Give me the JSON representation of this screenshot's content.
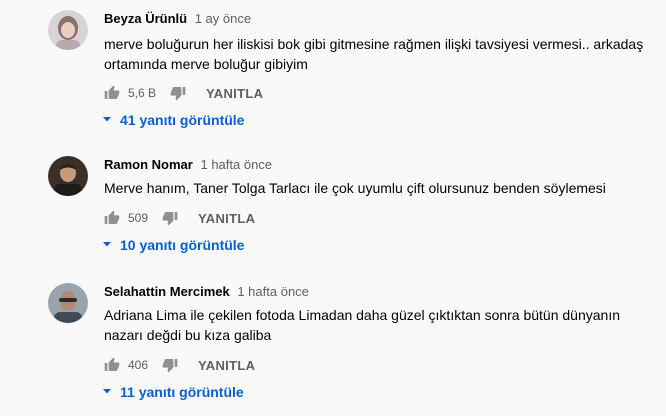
{
  "colors": {
    "link": "#065fd4",
    "meta": "#606060",
    "text": "#030303",
    "background": "#f9f9f9"
  },
  "comments": [
    {
      "author": "Beyza Ürünlü",
      "time": "1 ay önce",
      "text_lines": [
        "merve boluğurun her iliskisi bok gibi gitmesine rağmen ilişki tavsiyesi vermesi.. arkadaş",
        "ortamında merve boluğur gibiyim"
      ],
      "likes": "5,6 B",
      "reply_label": "YANITLA",
      "replies_label": "41 yanıtı görüntüle",
      "like_icon": "thumbs-up-icon",
      "dislike_icon": "thumbs-down-icon",
      "expand_icon": "caret-down-icon"
    },
    {
      "author": "Ramon Nomar",
      "time": "1 hafta önce",
      "text_lines": [
        "Merve hanım, Taner Tolga Tarlacı ile çok uyumlu çift olursunuz benden söylemesi"
      ],
      "likes": "509",
      "reply_label": "YANITLA",
      "replies_label": "10 yanıtı görüntüle",
      "like_icon": "thumbs-up-icon",
      "dislike_icon": "thumbs-down-icon",
      "expand_icon": "caret-down-icon"
    },
    {
      "author": "Selahattin Mercimek",
      "time": "1 hafta önce",
      "text_lines": [
        "Adriana Lima ile çekilen fotoda Limadan daha güzel çıktıktan sonra bütün dünyanın",
        "nazarı değdi bu kıza galiba"
      ],
      "likes": "406",
      "reply_label": "YANITLA",
      "replies_label": "11 yanıtı görüntüle",
      "like_icon": "thumbs-up-icon",
      "dislike_icon": "thumbs-down-icon",
      "expand_icon": "caret-down-icon"
    }
  ]
}
